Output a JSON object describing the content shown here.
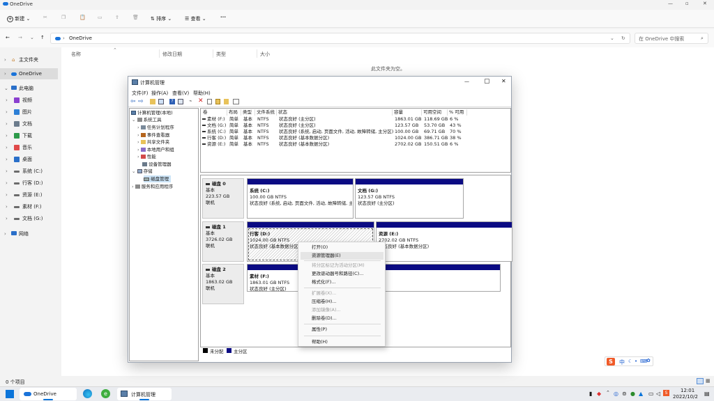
{
  "explorer": {
    "title": "OneDrive",
    "toolbar": {
      "new_label": "新建",
      "sort_label": "排序",
      "view_label": "查看",
      "more_label": "···"
    },
    "address": {
      "path": "OneDrive",
      "search_placeholder": "在 OneDrive 中搜索"
    },
    "columns": {
      "name": "名称",
      "modified": "修改日期",
      "type": "类型",
      "size": "大小"
    },
    "empty_text": "此文件夹为空。",
    "nav": {
      "home": "主文件夹",
      "onedrive": "OneDrive",
      "thispc": "此电脑",
      "items": [
        "视频",
        "图片",
        "文档",
        "下载",
        "音乐",
        "桌面",
        "系统 (C:)",
        "行客 (D:)",
        "资源 (E:)",
        "素材 (F:)",
        "文档 (G:)"
      ],
      "network": "网络"
    },
    "status": "0 个项目"
  },
  "mmc": {
    "title": "计算机管理",
    "menu": [
      "文件(F)",
      "操作(A)",
      "查看(V)",
      "帮助(H)"
    ],
    "tree": {
      "root": "计算机管理(本地)",
      "system_tools": "系统工具",
      "children": [
        "任务计划程序",
        "事件查看器",
        "共享文件夹",
        "本地用户和组",
        "性能",
        "设备管理器"
      ],
      "storage": "存储",
      "disk_mgmt": "磁盘管理",
      "services": "服务和应用程序"
    },
    "table": {
      "headers": [
        "卷",
        "布局",
        "类型",
        "文件系统",
        "状态",
        "容量",
        "可用空间",
        "% 可用"
      ],
      "rows": [
        [
          "素材 (F:)",
          "简单",
          "基本",
          "NTFS",
          "状态良好 (主分区)",
          "1863.01 GB",
          "118.69 GB",
          "6 %"
        ],
        [
          "文档 (G:)",
          "简单",
          "基本",
          "NTFS",
          "状态良好 (主分区)",
          "123.57 GB",
          "53.70 GB",
          "43 %"
        ],
        [
          "系统 (C:)",
          "简单",
          "基本",
          "NTFS",
          "状态良好 (系统, 启动, 页面文件, 活动, 故障转储, 主分区)",
          "100.00 GB",
          "69.71 GB",
          "70 %"
        ],
        [
          "行客 (D:)",
          "简单",
          "基本",
          "NTFS",
          "状态良好 (基本数据分区)",
          "1024.00 GB",
          "386.71 GB",
          "38 %"
        ],
        [
          "资源 (E:)",
          "简单",
          "基本",
          "NTFS",
          "状态良好 (基本数据分区)",
          "2702.02 GB",
          "150.51 GB",
          "6 %"
        ]
      ]
    },
    "disks": [
      {
        "name": "磁盘 0",
        "type": "基本",
        "size": "223.57 GB",
        "status": "联机",
        "parts": [
          {
            "name": "系统  (C:)",
            "size": "100.00 GB NTFS",
            "status": "状态良好 (系统, 启动, 页面文件, 活动, 故障转储, 主"
          },
          {
            "name": "文档  (G:)",
            "size": "123.57 GB NTFS",
            "status": "状态良好 (主分区)"
          }
        ]
      },
      {
        "name": "磁盘 1",
        "type": "基本",
        "size": "3726.02 GB",
        "status": "联机",
        "parts": [
          {
            "name": "行客  (D:)",
            "size": "1024.00 GB NTFS",
            "status": "状态良好 (基本数据分区)"
          },
          {
            "name": "资源  (E:)",
            "size": "2702.02 GB NTFS",
            "status": "状态良好 (基本数据分区)"
          }
        ]
      },
      {
        "name": "磁盘 2",
        "type": "基本",
        "size": "1863.02 GB",
        "status": "联机",
        "parts": [
          {
            "name": "素材  (F:)",
            "size": "1863.01 GB NTFS",
            "status": "状态良好 (主分区)"
          }
        ]
      }
    ],
    "legend": {
      "unallocated": "未分配",
      "primary": "主分区"
    }
  },
  "context_menu": {
    "items": [
      {
        "label": "打开(O)",
        "enabled": true
      },
      {
        "label": "资源管理器(E)",
        "enabled": true
      },
      {
        "label": "将分区标记为活动分区(M)",
        "enabled": false
      },
      {
        "label": "更改驱动器号和路径(C)...",
        "enabled": true
      },
      {
        "label": "格式化(F)...",
        "enabled": true
      },
      {
        "label": "扩展卷(X)...",
        "enabled": false
      },
      {
        "label": "压缩卷(H)...",
        "enabled": true
      },
      {
        "label": "添加镜像(A)...",
        "enabled": false
      },
      {
        "label": "删除卷(D)...",
        "enabled": true
      },
      {
        "label": "属性(P)",
        "enabled": true
      },
      {
        "label": "帮助(H)",
        "enabled": true
      }
    ]
  },
  "ime": {
    "label": "中"
  },
  "taskbar": {
    "onedrive_label": "OneDrive",
    "mmc_label": "计算机管理",
    "time": "12:01",
    "date": "2022/10/2"
  }
}
